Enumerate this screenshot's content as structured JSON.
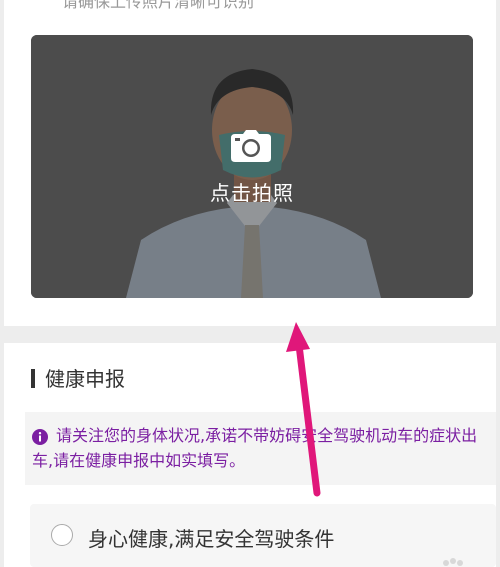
{
  "upload": {
    "hint": "请确保上传照片清晰可识别",
    "take_photo_label": "点击拍照",
    "camera_icon": "camera-icon"
  },
  "health": {
    "section_title": "健康申报",
    "notice_icon": "info-icon",
    "notice_text": "请关注您的身体状况,承诺不带妨碍安全驾驶机动车的症状出车,请在健康申报中如实填写。",
    "option_label": "身心健康,满足安全驾驶条件",
    "option_selected": false
  },
  "colors": {
    "notice": "#7b1fa2",
    "arrow": "#e0177a",
    "page_bg": "#ededed"
  }
}
